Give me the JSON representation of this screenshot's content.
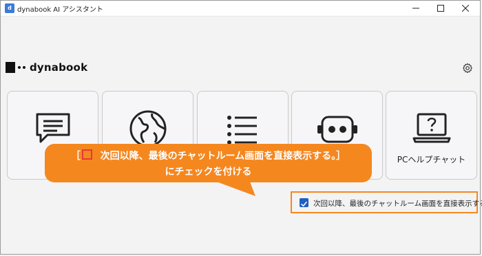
{
  "window": {
    "title": "dynabook AI アシスタント"
  },
  "brand": {
    "name": "dynabook"
  },
  "cards": [
    {
      "icon": "chat-bubble-icon",
      "label": ""
    },
    {
      "icon": "globe-icon",
      "label": ""
    },
    {
      "icon": "list-icon",
      "label": ""
    },
    {
      "icon": "robot-face-icon",
      "label": ""
    },
    {
      "icon": "laptop-help-icon",
      "label": "PCヘルプチャット"
    }
  ],
  "callout": {
    "line1_open": "［",
    "line1_text": "次回以降、最後のチャットルーム画面を直接表示する。］",
    "line2": "にチェックを付ける"
  },
  "checkbox": {
    "label": "次回以降、最後のチャットルーム画面を直接表示する。",
    "checked": true
  },
  "colors": {
    "callout": "#f5871f",
    "checkbox": "#1f5fbf",
    "bracket_box": "#e53935"
  }
}
